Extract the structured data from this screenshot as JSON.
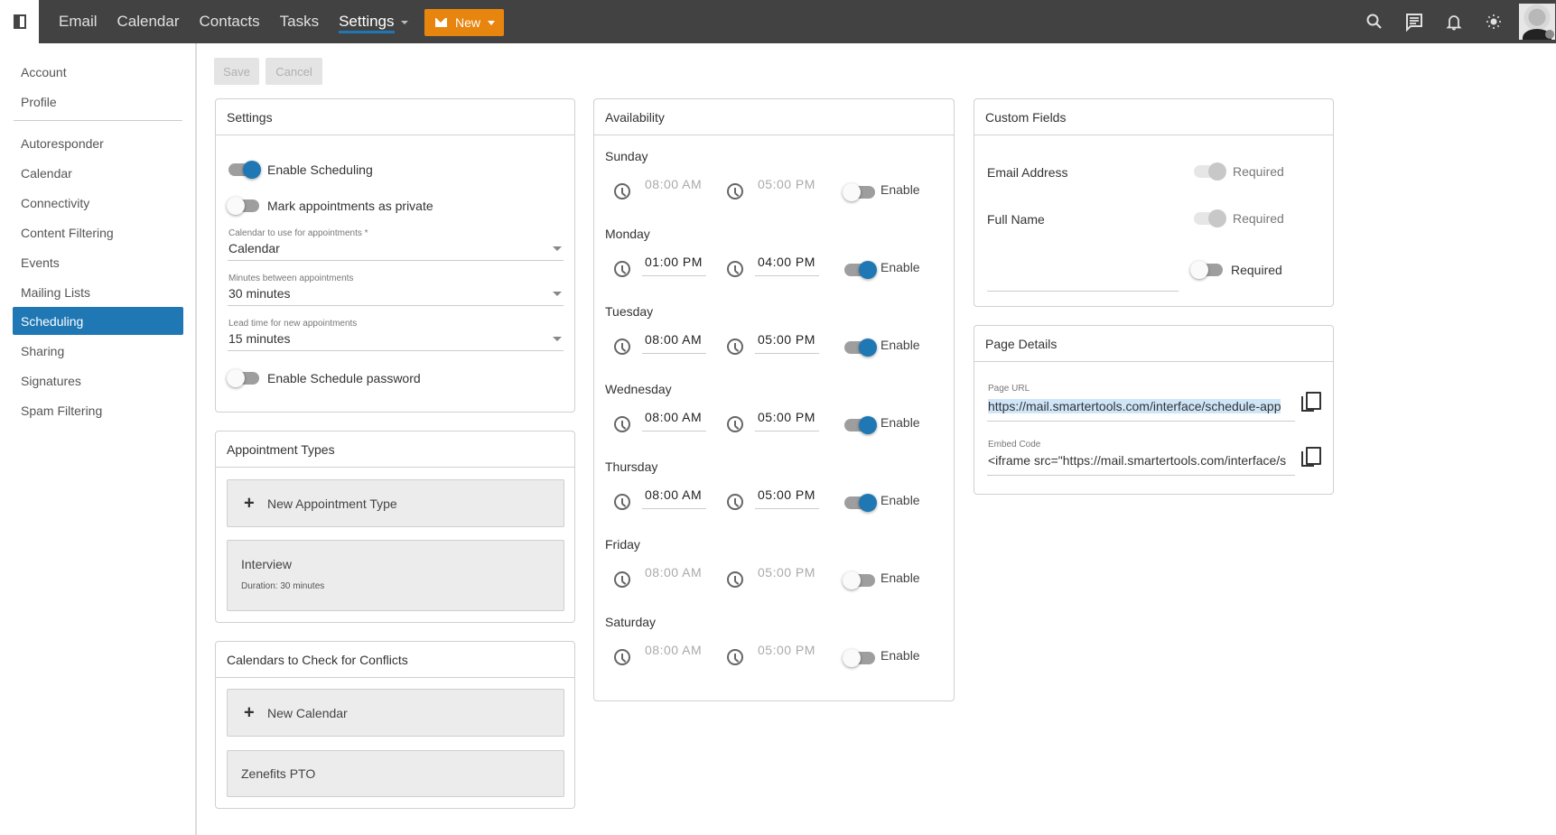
{
  "header": {
    "nav": [
      {
        "label": "Email",
        "active": false
      },
      {
        "label": "Calendar",
        "active": false
      },
      {
        "label": "Contacts",
        "active": false
      },
      {
        "label": "Tasks",
        "active": false
      },
      {
        "label": "Settings",
        "active": true,
        "has_dropdown": true
      }
    ],
    "new_button_label": "New",
    "icons": [
      "search-icon",
      "chat-icon",
      "bell-icon",
      "brightness-icon"
    ],
    "accent_color": "#1f77b4",
    "new_button_color": "#e8850f"
  },
  "sidebar": {
    "group1": [
      {
        "label": "Account"
      },
      {
        "label": "Profile"
      }
    ],
    "group2": [
      {
        "label": "Autoresponder"
      },
      {
        "label": "Calendar"
      },
      {
        "label": "Connectivity"
      },
      {
        "label": "Content Filtering"
      },
      {
        "label": "Events"
      },
      {
        "label": "Mailing Lists"
      },
      {
        "label": "Scheduling",
        "active": true
      },
      {
        "label": "Sharing"
      },
      {
        "label": "Signatures"
      },
      {
        "label": "Spam Filtering"
      }
    ]
  },
  "toolbar": {
    "save_label": "Save",
    "cancel_label": "Cancel"
  },
  "settings_panel": {
    "title": "Settings",
    "enable_scheduling": {
      "label": "Enable Scheduling",
      "on": true
    },
    "mark_private": {
      "label": "Mark appointments as private",
      "on": false
    },
    "calendar_field": {
      "label": "Calendar to use for appointments *",
      "value": "Calendar"
    },
    "minutes_field": {
      "label": "Minutes between appointments",
      "value": "30 minutes"
    },
    "lead_field": {
      "label": "Lead time for new appointments",
      "value": "15 minutes"
    },
    "schedule_password": {
      "label": "Enable Schedule password",
      "on": false
    }
  },
  "appointment_types": {
    "title": "Appointment Types",
    "new_label": "New Appointment Type",
    "items": [
      {
        "name": "Interview",
        "duration": "Duration: 30 minutes"
      }
    ]
  },
  "conflict_calendars": {
    "title": "Calendars to Check for Conflicts",
    "new_label": "New Calendar",
    "items": [
      {
        "name": "Zenefits PTO"
      }
    ]
  },
  "availability": {
    "title": "Availability",
    "enable_label": "Enable",
    "days": [
      {
        "day": "Sunday",
        "start": "08:00 AM",
        "end": "05:00 PM",
        "enabled": false
      },
      {
        "day": "Monday",
        "start": "01:00 PM",
        "end": "04:00 PM",
        "enabled": true
      },
      {
        "day": "Tuesday",
        "start": "08:00 AM",
        "end": "05:00 PM",
        "enabled": true
      },
      {
        "day": "Wednesday",
        "start": "08:00 AM",
        "end": "05:00 PM",
        "enabled": true
      },
      {
        "day": "Thursday",
        "start": "08:00 AM",
        "end": "05:00 PM",
        "enabled": true
      },
      {
        "day": "Friday",
        "start": "08:00 AM",
        "end": "05:00 PM",
        "enabled": false
      },
      {
        "day": "Saturday",
        "start": "08:00 AM",
        "end": "05:00 PM",
        "enabled": false
      }
    ]
  },
  "custom_fields": {
    "title": "Custom Fields",
    "required_label": "Required",
    "fields": [
      {
        "name": "Email Address",
        "required": true,
        "locked": true
      },
      {
        "name": "Full Name",
        "required": true,
        "locked": true
      },
      {
        "name": "",
        "required": false,
        "locked": false
      }
    ]
  },
  "page_details": {
    "title": "Page Details",
    "url_label": "Page URL",
    "url_value": "https://mail.smartertools.com/interface/schedule-app",
    "embed_label": "Embed Code",
    "embed_value": "<iframe src=\"https://mail.smartertools.com/interface/s"
  }
}
